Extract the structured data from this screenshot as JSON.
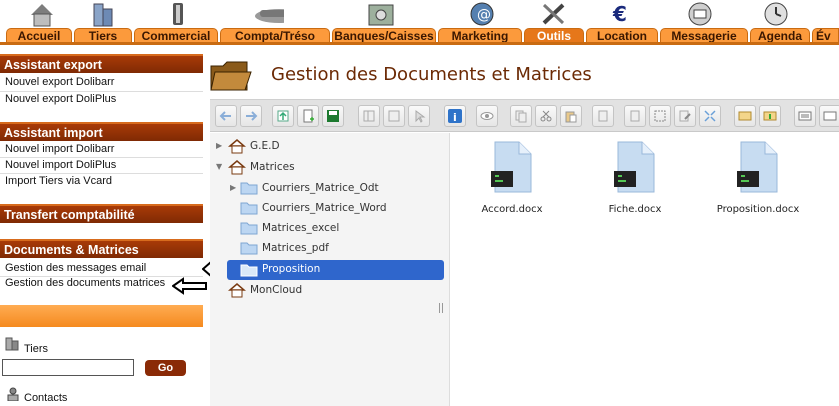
{
  "topnav": {
    "tabs": [
      {
        "label": "Accueil",
        "active": false
      },
      {
        "label": "Tiers",
        "active": false
      },
      {
        "label": "Commercial",
        "active": false
      },
      {
        "label": "Compta/Tréso",
        "active": false
      },
      {
        "label": "Banques/Caisses",
        "active": false
      },
      {
        "label": "Marketing",
        "active": false
      },
      {
        "label": "Outils",
        "active": true
      },
      {
        "label": "Location",
        "active": false
      },
      {
        "label": "Messagerie",
        "active": false
      },
      {
        "label": "Agenda",
        "active": false
      },
      {
        "label": "Év",
        "active": false
      }
    ]
  },
  "leftmenu": {
    "export": {
      "title": "Assistant export",
      "items": [
        "Nouvel export Dolibarr",
        "Nouvel export DoliPlus"
      ]
    },
    "import": {
      "title": "Assistant import",
      "items": [
        "Nouvel import Dolibarr",
        "Nouvel import DoliPlus",
        "Import Tiers via Vcard"
      ]
    },
    "transfer": {
      "title": "Transfert comptabilité"
    },
    "docs": {
      "title": "Documents & Matrices",
      "items": [
        "Gestion des messages email",
        "Gestion des documents matrices"
      ]
    },
    "tiers_label": "Tiers",
    "go_label": "Go",
    "contacts_label": "Contacts"
  },
  "main": {
    "title": "Gestion des Documents et Matrices",
    "tree": [
      {
        "label": "G.E.D"
      },
      {
        "label": "Matrices"
      },
      {
        "label": "Courriers_Matrice_Odt"
      },
      {
        "label": "Courriers_Matrice_Word"
      },
      {
        "label": "Matrices_excel"
      },
      {
        "label": "Matrices_pdf"
      },
      {
        "label": "Proposition"
      },
      {
        "label": "MonCloud"
      }
    ],
    "files": [
      "Accord.docx",
      "Fiche.docx",
      "Proposition.docx"
    ]
  },
  "colors": {
    "accent_orange": "#fc9a3c",
    "header_brown": "#8a2a06",
    "selection_blue": "#2f66cc"
  }
}
